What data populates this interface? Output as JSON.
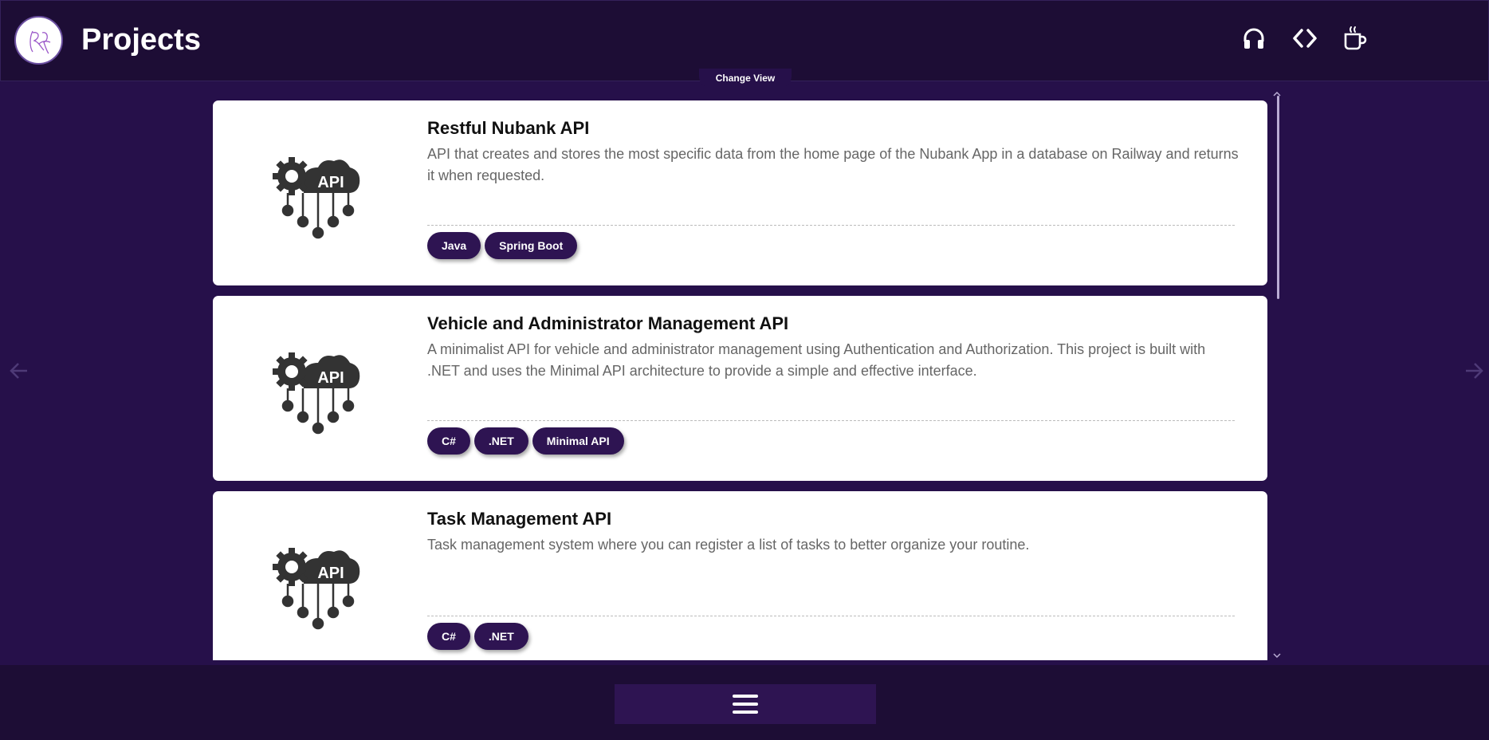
{
  "header": {
    "title": "Projects",
    "logo_icon": "signature-logo-icon",
    "actions": [
      {
        "icon": "headphones-icon"
      },
      {
        "icon": "code-icon"
      },
      {
        "icon": "coffee-cup-icon"
      }
    ]
  },
  "view_toggle": {
    "label": "Change View"
  },
  "projects": [
    {
      "icon": "api-cloud-gear-icon",
      "title": "Restful Nubank API",
      "description": "API that creates and stores the most specific data from the home page of the Nubank App in a database on Railway and returns it when requested.",
      "tags": [
        "Java",
        "Spring Boot"
      ]
    },
    {
      "icon": "api-cloud-gear-icon",
      "title": "Vehicle and Administrator Management API",
      "description": "A minimalist API for vehicle and administrator management using Authentication and Authorization. This project is built with .NET and uses the Minimal API architecture to provide a simple and effective interface.",
      "tags": [
        "C#",
        ".NET",
        "Minimal API"
      ]
    },
    {
      "icon": "api-cloud-gear-icon",
      "title": "Task Management API",
      "description": "Task management system where you can register a list of tasks to better organize your routine.",
      "tags": [
        "C#",
        ".NET"
      ]
    }
  ],
  "icon_label": "API",
  "navigation": {
    "prev_icon": "arrow-left-icon",
    "next_icon": "arrow-right-icon"
  },
  "footer": {
    "menu_icon": "hamburger-menu-icon"
  },
  "colors": {
    "background": "#26104a",
    "header": "#1d0d35",
    "tag": "#2e1452",
    "card": "#ffffff"
  }
}
